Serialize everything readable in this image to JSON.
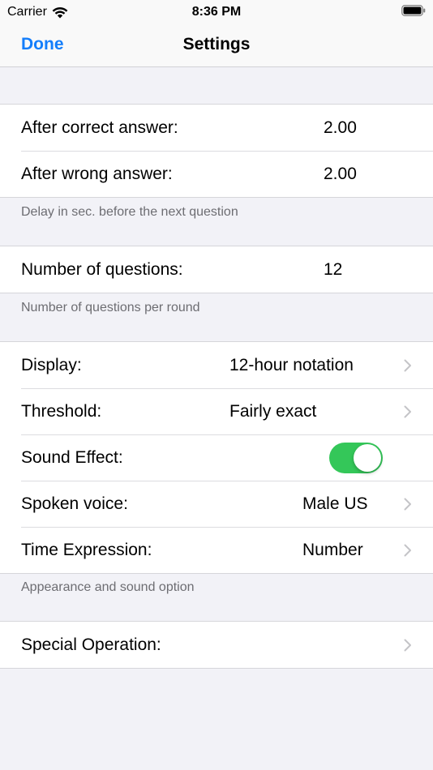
{
  "status_bar": {
    "carrier": "Carrier",
    "time": "8:36 PM",
    "wifi_icon": "wifi-icon",
    "battery_icon": "battery-icon"
  },
  "nav": {
    "done_label": "Done",
    "title": "Settings",
    "accent_color": "#147efb"
  },
  "delay_section": {
    "rows": [
      {
        "label": "After correct answer:",
        "value": "2.00"
      },
      {
        "label": "After wrong answer:",
        "value": "2.00"
      }
    ],
    "footer": "Delay in sec. before the next question"
  },
  "questions_section": {
    "rows": [
      {
        "label": "Number of questions:",
        "value": "12"
      }
    ],
    "footer": "Number of questions per round"
  },
  "appearance_section": {
    "rows": [
      {
        "label": "Display:",
        "value": "12-hour notation"
      },
      {
        "label": "Threshold:",
        "value": "Fairly exact"
      },
      {
        "label": "Sound Effect:",
        "toggle_on": true
      },
      {
        "label": "Spoken voice:",
        "value": "Male US"
      },
      {
        "label": "Time Expression:",
        "value": "Number"
      }
    ],
    "footer": "Appearance and sound option",
    "toggle_color": "#34c759"
  },
  "special_section": {
    "rows": [
      {
        "label": "Special Operation:"
      }
    ]
  }
}
